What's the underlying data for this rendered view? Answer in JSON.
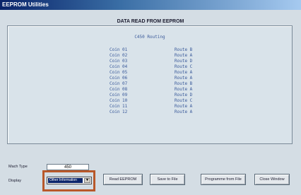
{
  "window": {
    "title": "EEPROM Utilities"
  },
  "header": {
    "title": "DATA READ FROM EEPROM"
  },
  "panel": {
    "title": "C450 Routing",
    "rows": [
      {
        "coin": "Coin 01",
        "route": "Route B"
      },
      {
        "coin": "Coin 02",
        "route": "Route A"
      },
      {
        "coin": "Coin 03",
        "route": "Route D"
      },
      {
        "coin": "Coin 04",
        "route": "Route C"
      },
      {
        "coin": "Coin 05",
        "route": "Route A"
      },
      {
        "coin": "Coin 06",
        "route": "Route A"
      },
      {
        "coin": "Coin 07",
        "route": "Route B"
      },
      {
        "coin": "Coin 08",
        "route": "Route A"
      },
      {
        "coin": "Coin 09",
        "route": "Route D"
      },
      {
        "coin": "Coin 10",
        "route": "Route C"
      },
      {
        "coin": "Coin 11",
        "route": "Route A"
      },
      {
        "coin": "Coin 12",
        "route": "Route A"
      }
    ]
  },
  "footer": {
    "mach_type_label": "Mach Type",
    "mach_type_value": "450",
    "display_label": "Display",
    "display_value": "Other Information",
    "buttons": {
      "read": "Read EEPROM",
      "save": "Save to File",
      "program": "Programme from File",
      "close": "Close Window"
    }
  },
  "colors": {
    "title_bar": "#0a246a",
    "highlight": "#b8582a",
    "data_text": "#3a5a9a"
  }
}
